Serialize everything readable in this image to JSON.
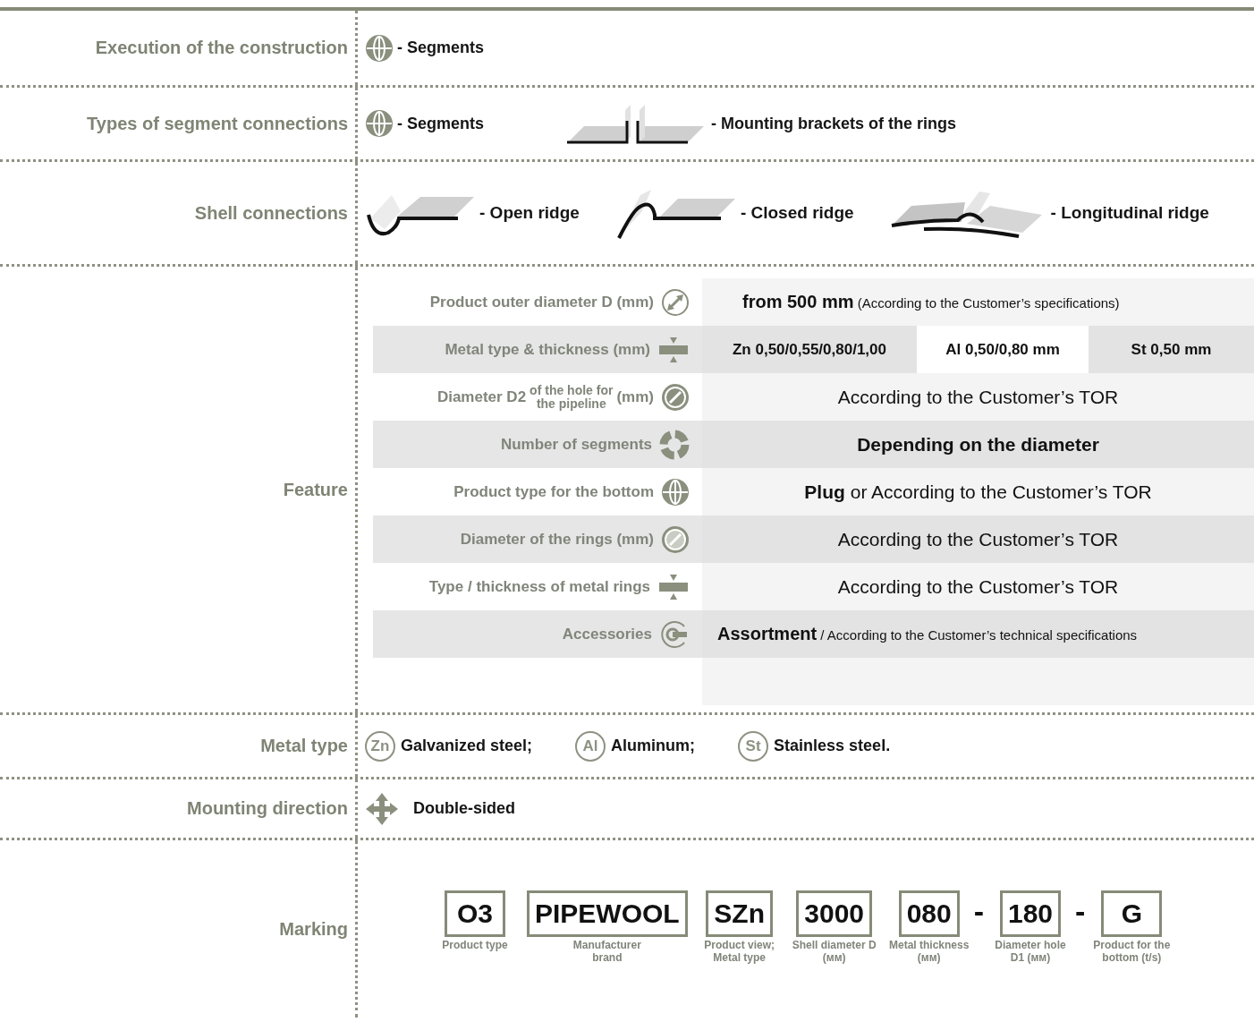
{
  "sections": [
    {
      "kind": "icons",
      "label": "Execution of the construction",
      "items": [
        {
          "kind": "globe",
          "text": "- Segments"
        }
      ]
    },
    {
      "kind": "icons",
      "label": "Types of segment connections",
      "items": [
        {
          "kind": "globe",
          "text": "- Segments"
        },
        {
          "kind": "bracket",
          "text": "- Mounting brackets of the rings"
        }
      ]
    },
    {
      "kind": "icons",
      "label": "Shell connections",
      "items": [
        {
          "kind": "open_ridge",
          "text": "- Open ridge"
        },
        {
          "kind": "closed_ridge",
          "text": "- Closed ridge"
        },
        {
          "kind": "long_ridge",
          "text": "- Longitudinal ridge"
        }
      ]
    },
    {
      "kind": "feature",
      "label": "Feature",
      "rows": [
        {
          "label": "Product outer diameter D (mm)",
          "kind": "diameter",
          "value": {
            "kind": "lead_note",
            "lead": "from 500 mm",
            "rest": "(According to the Customer’s specifications)"
          }
        },
        {
          "label": "Metal type & thickness (mm)",
          "kind": "thickness",
          "value": {
            "kind": "cells",
            "cells": [
              "Zn 0,50/0,55/0,80/1,00",
              "Al 0,50/0,80 mm",
              "St 0,50 mm"
            ]
          }
        },
        {
          "label": "Diameter D2",
          "label_stack": [
            "of the hole for",
            "the pipeline"
          ],
          "label_end": "(mm)",
          "kind": "hole",
          "value": {
            "kind": "plain",
            "text": "According to the Customer’s TOR"
          }
        },
        {
          "label": "Number of segments",
          "kind": "segments",
          "value": {
            "kind": "bold",
            "text": "Depending on the diameter"
          }
        },
        {
          "label": "Product type for the bottom",
          "kind": "globe",
          "value": {
            "kind": "lead_text",
            "lead": "Plug",
            "rest": "or According to the Customer’s TOR"
          }
        },
        {
          "label": "Diameter of the rings (mm)",
          "kind": "ring",
          "value": {
            "kind": "plain",
            "text": "According to the Customer’s TOR"
          }
        },
        {
          "label": "Type / thickness of metal rings",
          "kind": "thickness",
          "value": {
            "kind": "plain",
            "text": "According to the Customer’s TOR"
          }
        },
        {
          "label": "Accessories",
          "kind": "accessory",
          "value": {
            "kind": "lead_note",
            "lead": "Assortment",
            "rest": "/ According to the Customer’s technical specifications"
          }
        }
      ]
    },
    {
      "kind": "metals",
      "label": "Metal type",
      "items": [
        {
          "symbol": "Zn",
          "text": "Galvanized steel;"
        },
        {
          "symbol": "Al",
          "text": "Aluminum;"
        },
        {
          "symbol": "St",
          "text": "Stainless steel."
        }
      ]
    },
    {
      "kind": "icons",
      "label": "Mounting direction",
      "items": [
        {
          "kind": "move",
          "text": "Double-sided"
        }
      ]
    },
    {
      "kind": "marking",
      "label": "Marking",
      "codes": [
        {
          "kind": "box",
          "code": "O3",
          "caption": "Product type"
        },
        {
          "kind": "box",
          "code": "PIPEWOOL",
          "caption": "Manufacturer brand"
        },
        {
          "kind": "box",
          "code": "SZn",
          "caption": "Product view; Metal type"
        },
        {
          "kind": "box",
          "code": "3000",
          "caption": "Shell diameter D (мм)"
        },
        {
          "kind": "box",
          "code": "080",
          "caption": "Metal thickness (мм)"
        },
        {
          "kind": "dash",
          "text": "-"
        },
        {
          "kind": "box",
          "code": "180",
          "caption": "Diameter hole D1 (мм)"
        },
        {
          "kind": "dash",
          "text": "-"
        },
        {
          "kind": "box",
          "code": "G",
          "caption": "Product for the bottom (t/s)"
        }
      ]
    }
  ]
}
